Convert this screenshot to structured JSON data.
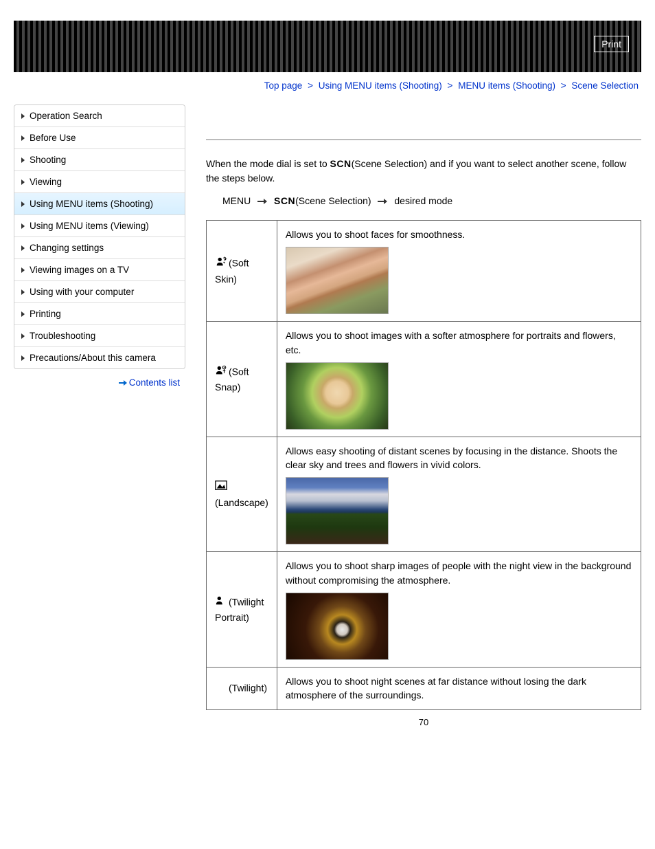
{
  "print_label": "Print",
  "breadcrumb": {
    "items": [
      "Top page",
      "Using MENU items (Shooting)",
      "MENU items (Shooting)",
      "Scene Selection"
    ]
  },
  "sidebar": {
    "items": [
      {
        "label": "Operation Search",
        "active": false
      },
      {
        "label": "Before Use",
        "active": false
      },
      {
        "label": "Shooting",
        "active": false
      },
      {
        "label": "Viewing",
        "active": false
      },
      {
        "label": "Using MENU items (Shooting)",
        "active": true
      },
      {
        "label": "Using MENU items (Viewing)",
        "active": false
      },
      {
        "label": "Changing settings",
        "active": false
      },
      {
        "label": "Viewing images on a TV",
        "active": false
      },
      {
        "label": "Using with your computer",
        "active": false
      },
      {
        "label": "Printing",
        "active": false
      },
      {
        "label": "Troubleshooting",
        "active": false
      },
      {
        "label": "Precautions/About this camera",
        "active": false
      }
    ]
  },
  "contents_list_label": "Contents list",
  "main": {
    "intro_pre": "When the mode dial is set to ",
    "scn": "SCN",
    "intro_post": "(Scene Selection) and if you want to select another scene, follow the steps below.",
    "path": {
      "menu": "MENU",
      "scn_label": "(Scene Selection)",
      "desired": "desired mode"
    },
    "rows": [
      {
        "mode": "(Soft Skin)",
        "icon": "soft-skin-icon",
        "desc": "Allows you to shoot faces for smoothness.",
        "img_class": "img-softskin"
      },
      {
        "mode": "(Soft Snap)",
        "icon": "soft-snap-icon",
        "desc": "Allows you to shoot images with a softer atmosphere for portraits and flowers, etc.",
        "img_class": "img-softsnap"
      },
      {
        "mode": "(Landscape)",
        "icon": "landscape-icon",
        "desc": "Allows easy shooting of distant scenes by focusing in the distance. Shoots the clear sky and trees and flowers in vivid colors.",
        "img_class": "img-landscape"
      },
      {
        "mode": "(Twilight Portrait)",
        "icon": "twilight-portrait-icon",
        "desc": "Allows you to shoot sharp images of people with the night view in the background without compromising the atmosphere.",
        "img_class": "img-twilightportrait"
      },
      {
        "mode": "(Twilight)",
        "icon": "twilight-icon",
        "desc": "Allows you to shoot night scenes at far distance without losing the dark atmosphere of the surroundings.",
        "img_class": ""
      }
    ]
  },
  "page_number": "70"
}
